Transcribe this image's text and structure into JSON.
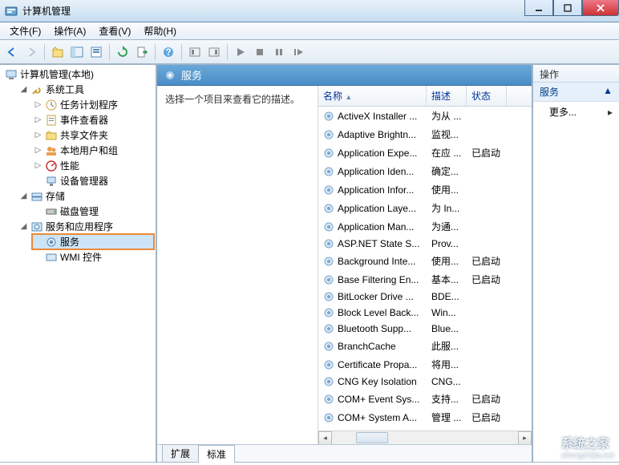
{
  "window": {
    "title": "计算机管理"
  },
  "menu": {
    "file": "文件(F)",
    "action": "操作(A)",
    "view": "查看(V)",
    "help": "帮助(H)"
  },
  "tree": {
    "root": "计算机管理(本地)",
    "system_tools": "系统工具",
    "task_scheduler": "任务计划程序",
    "event_viewer": "事件查看器",
    "shared_folders": "共享文件夹",
    "local_users": "本地用户和组",
    "performance": "性能",
    "device_manager": "设备管理器",
    "storage": "存储",
    "disk_mgmt": "磁盘管理",
    "services_apps": "服务和应用程序",
    "services": "服务",
    "wmi": "WMI 控件"
  },
  "center": {
    "header": "服务",
    "description": "选择一个项目来查看它的描述。",
    "columns": {
      "name": "名称",
      "desc": "描述",
      "status": "状态"
    },
    "status_started": "已启动",
    "tabs": {
      "extended": "扩展",
      "standard": "标准"
    }
  },
  "services": [
    {
      "name": "ActiveX Installer ...",
      "desc": "为从 ...",
      "status": ""
    },
    {
      "name": "Adaptive Brightn...",
      "desc": "监视...",
      "status": ""
    },
    {
      "name": "Application Expe...",
      "desc": "在应 ...",
      "status": "已启动"
    },
    {
      "name": "Application Iden...",
      "desc": "确定...",
      "status": ""
    },
    {
      "name": "Application Infor...",
      "desc": "使用...",
      "status": ""
    },
    {
      "name": "Application Laye...",
      "desc": "为 In...",
      "status": ""
    },
    {
      "name": "Application Man...",
      "desc": "为通...",
      "status": ""
    },
    {
      "name": "ASP.NET State S...",
      "desc": "Prov...",
      "status": ""
    },
    {
      "name": "Background Inte...",
      "desc": "使用...",
      "status": "已启动"
    },
    {
      "name": "Base Filtering En...",
      "desc": "基本...",
      "status": "已启动"
    },
    {
      "name": "BitLocker Drive ...",
      "desc": "BDE...",
      "status": ""
    },
    {
      "name": "Block Level Back...",
      "desc": "Win...",
      "status": ""
    },
    {
      "name": "Bluetooth Supp...",
      "desc": "Blue...",
      "status": ""
    },
    {
      "name": "BranchCache",
      "desc": "此服...",
      "status": ""
    },
    {
      "name": "Certificate Propa...",
      "desc": "将用...",
      "status": ""
    },
    {
      "name": "CNG Key Isolation",
      "desc": "CNG...",
      "status": ""
    },
    {
      "name": "COM+ Event Sys...",
      "desc": "支持...",
      "status": "已启动"
    },
    {
      "name": "COM+ System A...",
      "desc": "管理 ...",
      "status": "已启动"
    }
  ],
  "actions": {
    "header": "操作",
    "group": "服务",
    "more": "更多..."
  },
  "watermark": {
    "text": "系统之家",
    "url": "xitongzhijia.net"
  }
}
